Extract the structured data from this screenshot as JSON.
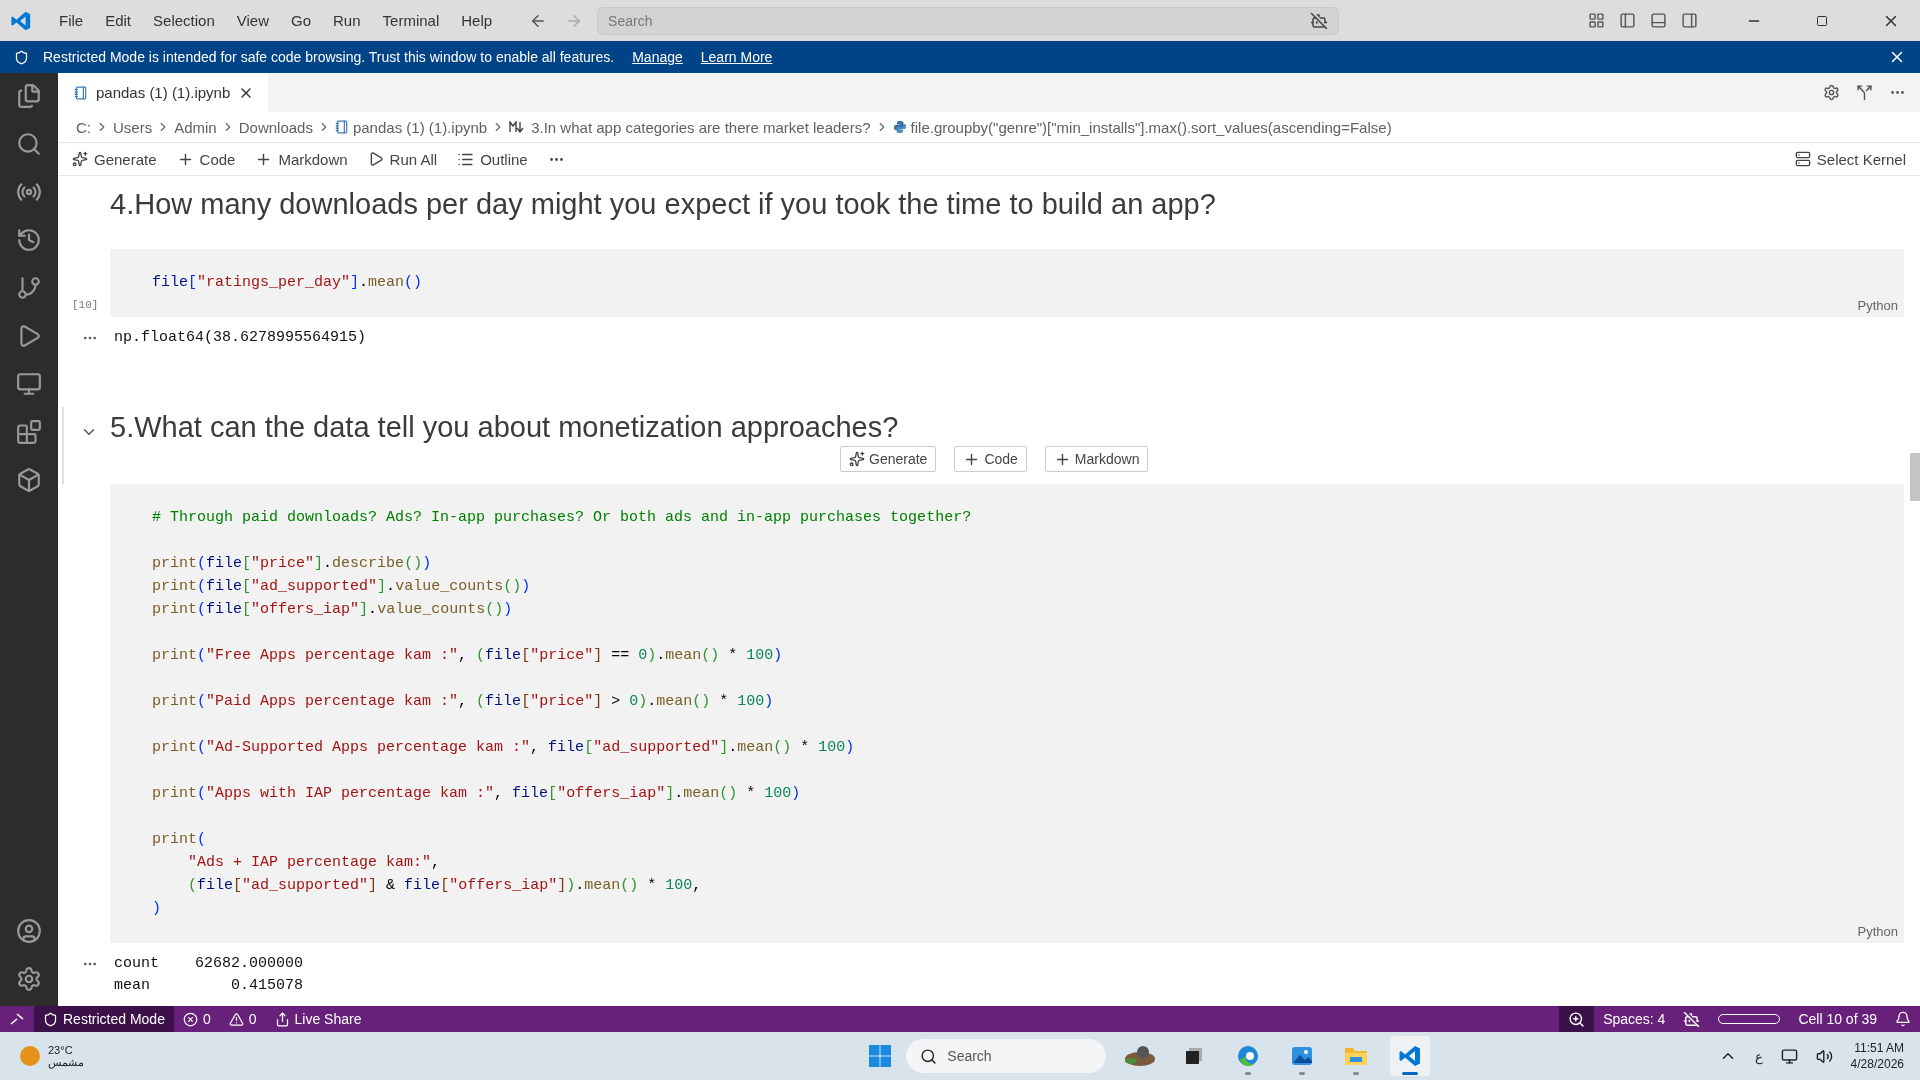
{
  "menu": [
    "File",
    "Edit",
    "Selection",
    "View",
    "Go",
    "Run",
    "Terminal",
    "Help"
  ],
  "title_search": {
    "placeholder": "Search"
  },
  "banner": {
    "text": "Restricted Mode is intended for safe code browsing. Trust this window to enable all features.",
    "links": [
      "Manage",
      "Learn More"
    ]
  },
  "tab": {
    "label": "pandas (1) (1).ipynb",
    "selected": true
  },
  "breadcrumbs": [
    {
      "kind": "plain",
      "text": "C:"
    },
    {
      "kind": "plain",
      "text": "Users"
    },
    {
      "kind": "plain",
      "text": "Admin"
    },
    {
      "kind": "plain",
      "text": "Downloads"
    },
    {
      "kind": "notebook",
      "text": "pandas (1) (1).ipynb"
    },
    {
      "kind": "markdown",
      "text": "3.In what app categories are there market leaders?"
    },
    {
      "kind": "python",
      "text": "file.groupby(\"genre\")[\"min_installs\"].max().sort_values(ascending=False)"
    }
  ],
  "toolbar": [
    {
      "kind": "generate",
      "label": "Generate"
    },
    {
      "kind": "add",
      "label": "Code"
    },
    {
      "kind": "add",
      "label": "Markdown"
    },
    {
      "kind": "run",
      "label": "Run All"
    },
    {
      "kind": "outline",
      "label": "Outline"
    },
    {
      "kind": "more"
    }
  ],
  "kernel": "Select Kernel",
  "cells": [
    {
      "kind": "markdown",
      "heading": "4.How many downloads per day might you expect if you took the time to build an app?",
      "focused": false
    },
    {
      "kind": "code",
      "count": "[10]",
      "lang": "Python",
      "lines": [
        {
          "tokens": [
            {
              "kind": "var",
              "text": "file"
            },
            {
              "kind": "b1",
              "text": "["
            },
            {
              "kind": "str",
              "text": "\"ratings_per_day\""
            },
            {
              "kind": "b1",
              "text": "]"
            },
            {
              "kind": "punc",
              "text": "."
            },
            {
              "kind": "fn",
              "text": "mean"
            },
            {
              "kind": "b1",
              "text": "()"
            }
          ]
        }
      ],
      "output": [
        "np.float64(38.6278995564915)"
      ]
    },
    {
      "kind": "markdown",
      "heading": "5.What can the data tell you about monetization approaches?",
      "focused": true,
      "insert_buttons": [
        {
          "kind": "generate",
          "label": "Generate"
        },
        {
          "kind": "add",
          "label": "Code"
        },
        {
          "kind": "add",
          "label": "Markdown"
        }
      ]
    },
    {
      "kind": "code",
      "lang": "Python",
      "lines": [
        {
          "tokens": [
            {
              "kind": "cmt",
              "text": "# Through paid downloads? Ads? In-app purchases? Or both ads and in-app purchases together?"
            }
          ]
        },
        {
          "kind": "blank"
        },
        {
          "tokens": [
            {
              "kind": "fn",
              "text": "print"
            },
            {
              "kind": "b1",
              "text": "("
            },
            {
              "kind": "var",
              "text": "file"
            },
            {
              "kind": "b2",
              "text": "["
            },
            {
              "kind": "str",
              "text": "\"price\""
            },
            {
              "kind": "b2",
              "text": "]"
            },
            {
              "kind": "punc",
              "text": "."
            },
            {
              "kind": "fn",
              "text": "describe"
            },
            {
              "kind": "b2",
              "text": "()"
            },
            {
              "kind": "b1",
              "text": ")"
            }
          ]
        },
        {
          "tokens": [
            {
              "kind": "fn",
              "text": "print"
            },
            {
              "kind": "b1",
              "text": "("
            },
            {
              "kind": "var",
              "text": "file"
            },
            {
              "kind": "b2",
              "text": "["
            },
            {
              "kind": "str",
              "text": "\"ad_supported\""
            },
            {
              "kind": "b2",
              "text": "]"
            },
            {
              "kind": "punc",
              "text": "."
            },
            {
              "kind": "fn",
              "text": "value_counts"
            },
            {
              "kind": "b2",
              "text": "()"
            },
            {
              "kind": "b1",
              "text": ")"
            }
          ]
        },
        {
          "tokens": [
            {
              "kind": "fn",
              "text": "print"
            },
            {
              "kind": "b1",
              "text": "("
            },
            {
              "kind": "var",
              "text": "file"
            },
            {
              "kind": "b2",
              "text": "["
            },
            {
              "kind": "str",
              "text": "\"offers_iap\""
            },
            {
              "kind": "b2",
              "text": "]"
            },
            {
              "kind": "punc",
              "text": "."
            },
            {
              "kind": "fn",
              "text": "value_counts"
            },
            {
              "kind": "b2",
              "text": "()"
            },
            {
              "kind": "b1",
              "text": ")"
            }
          ]
        },
        {
          "kind": "blank"
        },
        {
          "tokens": [
            {
              "kind": "fn",
              "text": "print"
            },
            {
              "kind": "b1",
              "text": "("
            },
            {
              "kind": "str",
              "text": "\"Free Apps percentage kam :\""
            },
            {
              "kind": "punc",
              "text": ", "
            },
            {
              "kind": "b2",
              "text": "("
            },
            {
              "kind": "var",
              "text": "file"
            },
            {
              "kind": "b3",
              "text": "["
            },
            {
              "kind": "str",
              "text": "\"price\""
            },
            {
              "kind": "b3",
              "text": "]"
            },
            {
              "kind": "punc",
              "text": " == "
            },
            {
              "kind": "num",
              "text": "0"
            },
            {
              "kind": "b2",
              "text": ")"
            },
            {
              "kind": "punc",
              "text": "."
            },
            {
              "kind": "fn",
              "text": "mean"
            },
            {
              "kind": "b2",
              "text": "()"
            },
            {
              "kind": "punc",
              "text": " * "
            },
            {
              "kind": "num",
              "text": "100"
            },
            {
              "kind": "b1",
              "text": ")"
            }
          ]
        },
        {
          "kind": "blank"
        },
        {
          "tokens": [
            {
              "kind": "fn",
              "text": "print"
            },
            {
              "kind": "b1",
              "text": "("
            },
            {
              "kind": "str",
              "text": "\"Paid Apps percentage kam :\""
            },
            {
              "kind": "punc",
              "text": ", "
            },
            {
              "kind": "b2",
              "text": "("
            },
            {
              "kind": "var",
              "text": "file"
            },
            {
              "kind": "b3",
              "text": "["
            },
            {
              "kind": "str",
              "text": "\"price\""
            },
            {
              "kind": "b3",
              "text": "]"
            },
            {
              "kind": "punc",
              "text": " > "
            },
            {
              "kind": "num",
              "text": "0"
            },
            {
              "kind": "b2",
              "text": ")"
            },
            {
              "kind": "punc",
              "text": "."
            },
            {
              "kind": "fn",
              "text": "mean"
            },
            {
              "kind": "b2",
              "text": "()"
            },
            {
              "kind": "punc",
              "text": " * "
            },
            {
              "kind": "num",
              "text": "100"
            },
            {
              "kind": "b1",
              "text": ")"
            }
          ]
        },
        {
          "kind": "blank"
        },
        {
          "tokens": [
            {
              "kind": "fn",
              "text": "print"
            },
            {
              "kind": "b1",
              "text": "("
            },
            {
              "kind": "str",
              "text": "\"Ad-Supported Apps percentage kam :\""
            },
            {
              "kind": "punc",
              "text": ", "
            },
            {
              "kind": "var",
              "text": "file"
            },
            {
              "kind": "b2",
              "text": "["
            },
            {
              "kind": "str",
              "text": "\"ad_supported\""
            },
            {
              "kind": "b2",
              "text": "]"
            },
            {
              "kind": "punc",
              "text": "."
            },
            {
              "kind": "fn",
              "text": "mean"
            },
            {
              "kind": "b2",
              "text": "()"
            },
            {
              "kind": "punc",
              "text": " * "
            },
            {
              "kind": "num",
              "text": "100"
            },
            {
              "kind": "b1",
              "text": ")"
            }
          ]
        },
        {
          "kind": "blank"
        },
        {
          "tokens": [
            {
              "kind": "fn",
              "text": "print"
            },
            {
              "kind": "b1",
              "text": "("
            },
            {
              "kind": "str",
              "text": "\"Apps with IAP percentage kam :\""
            },
            {
              "kind": "punc",
              "text": ", "
            },
            {
              "kind": "var",
              "text": "file"
            },
            {
              "kind": "b2",
              "text": "["
            },
            {
              "kind": "str",
              "text": "\"offers_iap\""
            },
            {
              "kind": "b2",
              "text": "]"
            },
            {
              "kind": "punc",
              "text": "."
            },
            {
              "kind": "fn",
              "text": "mean"
            },
            {
              "kind": "b2",
              "text": "()"
            },
            {
              "kind": "punc",
              "text": " * "
            },
            {
              "kind": "num",
              "text": "100"
            },
            {
              "kind": "b1",
              "text": ")"
            }
          ]
        },
        {
          "kind": "blank"
        },
        {
          "tokens": [
            {
              "kind": "fn",
              "text": "print"
            },
            {
              "kind": "b1",
              "text": "("
            }
          ]
        },
        {
          "indented": true,
          "tokens": [
            {
              "kind": "str",
              "text": "\"Ads + IAP percentage kam:\""
            },
            {
              "kind": "punc",
              "text": ","
            }
          ]
        },
        {
          "indented": true,
          "tokens": [
            {
              "kind": "b2",
              "text": "("
            },
            {
              "kind": "var",
              "text": "file"
            },
            {
              "kind": "b3",
              "text": "["
            },
            {
              "kind": "str",
              "text": "\"ad_supported\""
            },
            {
              "kind": "b3",
              "text": "]"
            },
            {
              "kind": "punc",
              "text": " & "
            },
            {
              "kind": "var",
              "text": "file"
            },
            {
              "kind": "b3",
              "text": "["
            },
            {
              "kind": "str",
              "text": "\"offers_iap\""
            },
            {
              "kind": "b3",
              "text": "]"
            },
            {
              "kind": "b2",
              "text": ")"
            },
            {
              "kind": "punc",
              "text": "."
            },
            {
              "kind": "fn",
              "text": "mean"
            },
            {
              "kind": "b2",
              "text": "()"
            },
            {
              "kind": "punc",
              "text": " * "
            },
            {
              "kind": "num",
              "text": "100"
            },
            {
              "kind": "punc",
              "text": ","
            }
          ]
        },
        {
          "tokens": [
            {
              "kind": "b1",
              "text": ")"
            }
          ]
        }
      ],
      "output": [
        "count    62682.000000",
        "mean         0.415078"
      ]
    }
  ],
  "status_left": [
    {
      "kind": "restricted",
      "label": "Restricted Mode"
    },
    {
      "kind": "errors",
      "label": "0"
    },
    {
      "kind": "warnings",
      "label": "0"
    },
    {
      "kind": "share",
      "label": "Live Share"
    }
  ],
  "status_right": [
    {
      "kind": "zoom"
    },
    {
      "kind": "text",
      "label": "Spaces: 4"
    },
    {
      "kind": "copilot"
    },
    {
      "kind": "progress"
    },
    {
      "kind": "text",
      "label": "Cell 10 of 39"
    },
    {
      "kind": "bell"
    }
  ],
  "weather": {
    "temp": "23°C",
    "condition": "مشمس"
  },
  "taskbar_search": {
    "placeholder": "Search"
  },
  "taskbar_apps": [
    {
      "kind": "widget",
      "running": false,
      "selected": false
    },
    {
      "kind": "taskview",
      "running": false,
      "selected": false
    },
    {
      "kind": "edge",
      "running": true,
      "selected": false
    },
    {
      "kind": "photos",
      "running": true,
      "selected": false
    },
    {
      "kind": "folder",
      "running": true,
      "selected": false
    },
    {
      "kind": "vscode",
      "running": true,
      "selected": true
    }
  ],
  "tray": {
    "keyboard": "ع",
    "time": "11:51 AM",
    "date": "4/28/2026"
  }
}
